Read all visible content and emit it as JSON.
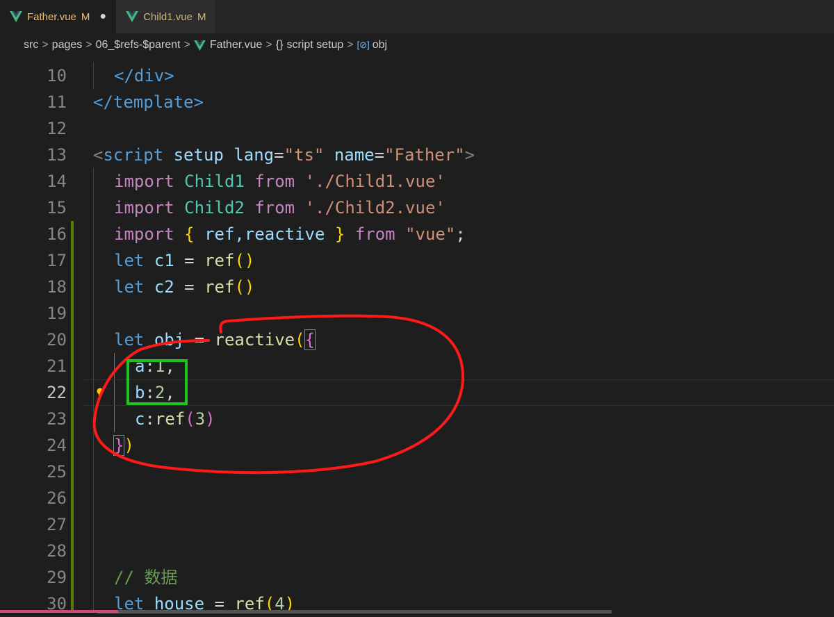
{
  "tabs": [
    {
      "name": "Father.vue",
      "status": "M",
      "dirty_dot": "●"
    },
    {
      "name": "Child1.vue",
      "status": "M"
    }
  ],
  "breadcrumb": {
    "items": [
      "src",
      "pages",
      "06_$refs-$parent",
      "Father.vue",
      "script setup",
      "obj"
    ],
    "separator": ">",
    "bracket_icon": "{}",
    "var_icon": "[⊘]"
  },
  "editor": {
    "current_line": 22,
    "lines": [
      {
        "n": "10"
      },
      {
        "n": "11"
      },
      {
        "n": "12"
      },
      {
        "n": "13"
      },
      {
        "n": "14"
      },
      {
        "n": "15"
      },
      {
        "n": "16"
      },
      {
        "n": "17"
      },
      {
        "n": "18"
      },
      {
        "n": "19"
      },
      {
        "n": "20"
      },
      {
        "n": "21"
      },
      {
        "n": "22"
      },
      {
        "n": "23"
      },
      {
        "n": "24"
      },
      {
        "n": "25"
      },
      {
        "n": "26"
      },
      {
        "n": "27"
      },
      {
        "n": "28"
      },
      {
        "n": "29"
      },
      {
        "n": "30"
      }
    ],
    "tokens": {
      "div_close": "</div>",
      "template_close": "</template>",
      "script_open": "script",
      "setup": "setup",
      "lang": "lang",
      "lang_val": "\"ts\"",
      "name": "name",
      "name_val": "\"Father\"",
      "import": "import",
      "from": "from",
      "child1": "Child1",
      "child1_path": "'./Child1.vue'",
      "child2": "Child2",
      "child2_path": "'./Child2.vue'",
      "ref_reactive": "ref,reactive",
      "vue": "\"vue\"",
      "let": "let",
      "c1": "c1",
      "c2": "c2",
      "ref": "ref",
      "obj": "obj",
      "reactive": "reactive",
      "a": "a",
      "one": "1",
      "b": "b",
      "two": "2",
      "c": "c",
      "three": "3",
      "comment": "// 数据",
      "house": "house",
      "four": "4"
    }
  },
  "colors": {
    "red_annotation": "#ff1a1a",
    "green_annotation": "#1ec41e",
    "vue_green": "#41b883"
  },
  "icons": [
    "vue-icon",
    "lightbulb-icon",
    "braces-icon",
    "variable-icon"
  ]
}
